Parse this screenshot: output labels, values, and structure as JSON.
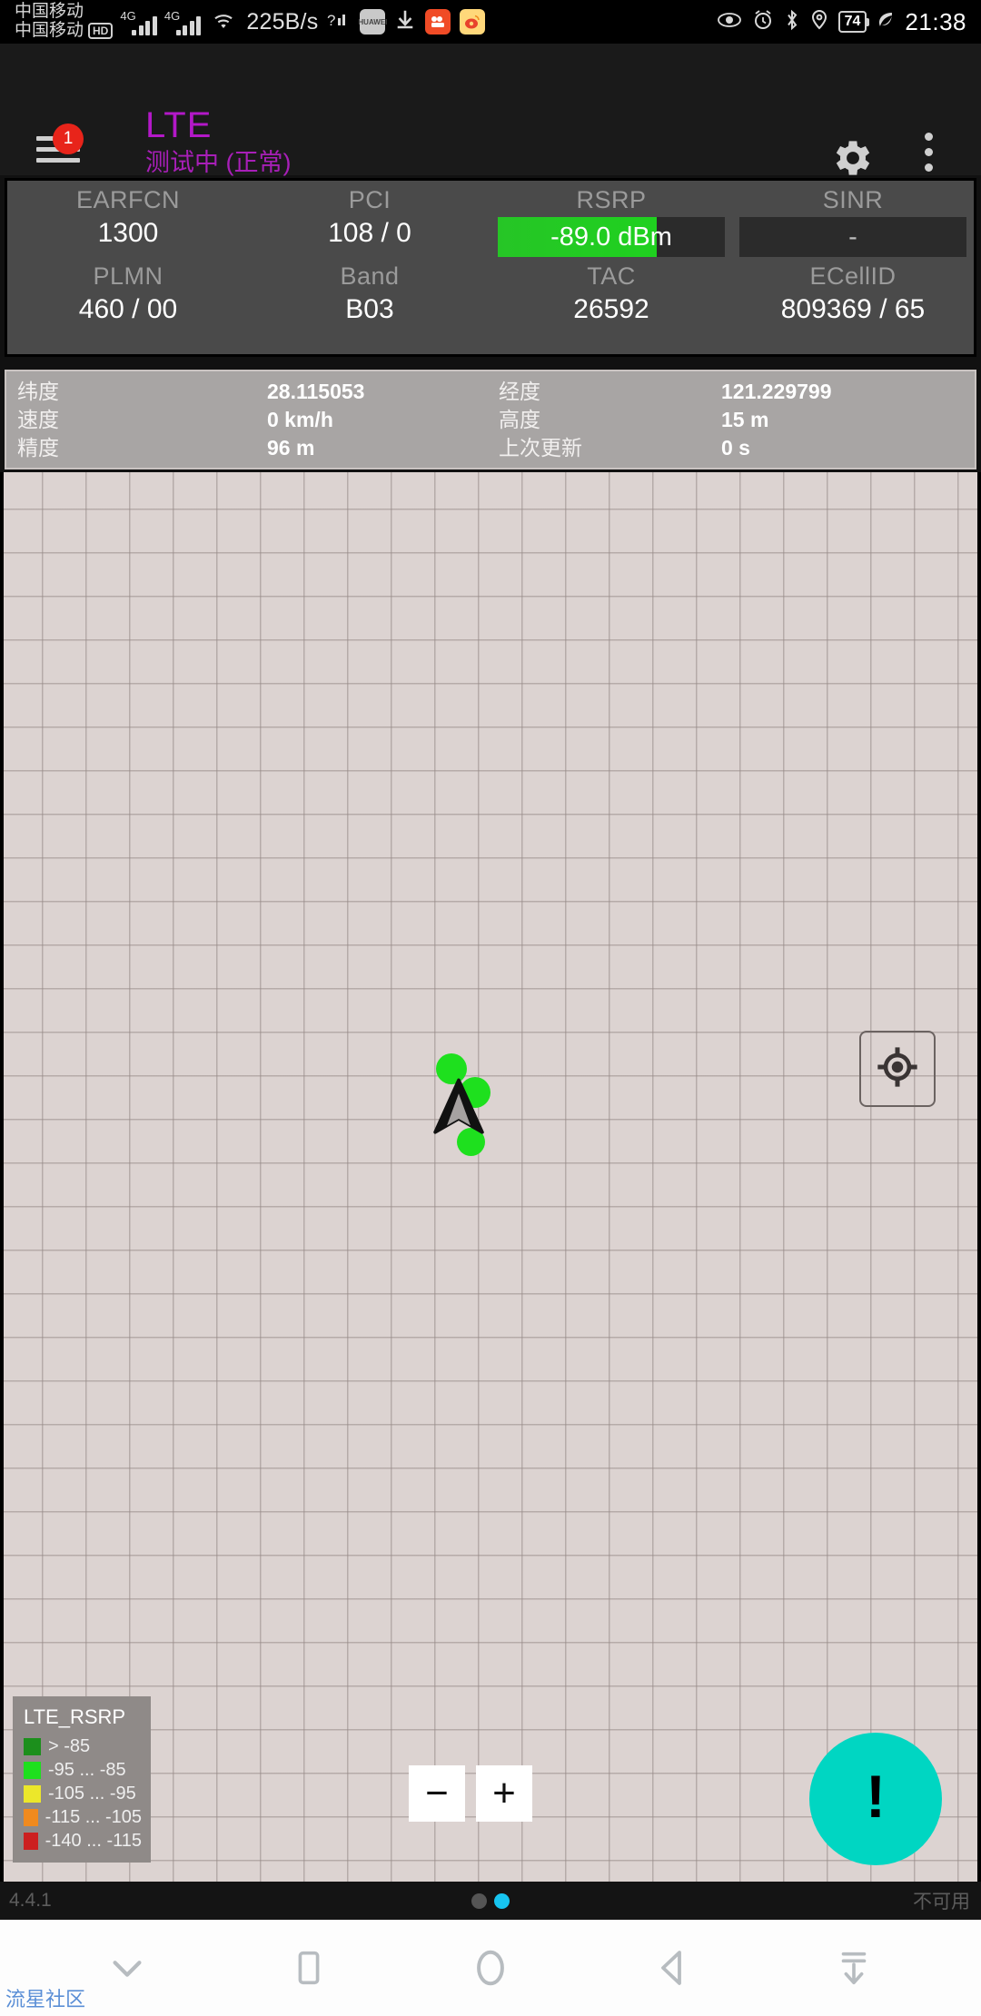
{
  "status_bar": {
    "carrier_line1": "中国移动",
    "carrier_line2": "中国移动",
    "volte_badge": "HD",
    "network_type_1": "4G",
    "network_type_2": "4G",
    "network_speed": "225B/s",
    "unknown_sim_icon": "?",
    "app_icon_huawei": "HUAWEI",
    "app_icon_download": "download-icon",
    "app_icon_recorder": "recorder-icon",
    "app_icon_weibo": "weibo-icon",
    "eye_icon": "eye-comfort-icon",
    "alarm_icon": "alarm-icon",
    "bluetooth_icon": "bluetooth-icon",
    "location_icon": "location-icon",
    "battery_level": "74",
    "power_save_icon": "leaf-icon",
    "clock": "21:38"
  },
  "app_bar": {
    "menu_badge": "1",
    "title": "LTE",
    "subtitle": "测试中 (正常)",
    "settings_icon": "gear-icon",
    "overflow_icon": "more-vertical-icon",
    "title_color": "#b318c8"
  },
  "stats": {
    "row1": [
      {
        "label": "EARFCN",
        "value": "1300",
        "type": "text"
      },
      {
        "label": "PCI",
        "value": "108 / 0",
        "type": "text"
      },
      {
        "label": "RSRP",
        "value": "-89.0 dBm",
        "type": "bar",
        "fill_percent": 70,
        "fill_color": "#1fd11f"
      },
      {
        "label": "SINR",
        "value": "-",
        "type": "bar",
        "fill_percent": 0,
        "fill_color": "#1fd11f"
      }
    ],
    "row2": [
      {
        "label": "PLMN",
        "value": "460 / 00"
      },
      {
        "label": "Band",
        "value": "B03"
      },
      {
        "label": "TAC",
        "value": "26592"
      },
      {
        "label": "ECellID",
        "value": "809369 / 65"
      }
    ]
  },
  "gps": {
    "latitude_label": "纬度",
    "latitude_value": "28.115053",
    "longitude_label": "经度",
    "longitude_value": "121.229799",
    "speed_label": "速度",
    "speed_value": "0 km/h",
    "altitude_label": "高度",
    "altitude_value": "15 m",
    "accuracy_label": "精度",
    "accuracy_value": "96 m",
    "last_update_label": "上次更新",
    "last_update_value": "0 s"
  },
  "map": {
    "locate_icon": "crosshair-icon",
    "zoom_out_label": "−",
    "zoom_in_label": "+",
    "alert_fab_label": "!",
    "alert_fab_color": "#00d6c2",
    "marker_icon": "navigation-arrow-icon",
    "sample_dot_color": "#1ee01e",
    "background_color": "#dcd3d1"
  },
  "legend": {
    "title": "LTE_RSRP",
    "items": [
      {
        "color": "#1c8f1c",
        "range": "> -85"
      },
      {
        "color": "#1ee01e",
        "range": "-95 ... -85"
      },
      {
        "color": "#ece72a",
        "range": "-105 ... -95"
      },
      {
        "color": "#f08a1e",
        "range": "-115 ... -105"
      },
      {
        "color": "#cc2020",
        "range": "-140 ... -115"
      }
    ]
  },
  "footer": {
    "version": "4.4.1",
    "status": "不可用",
    "page_index": 1,
    "page_count": 2
  },
  "nav_bar": {
    "buttons": [
      {
        "name": "hide-navbar-button",
        "icon": "chevron-down-icon"
      },
      {
        "name": "recents-button",
        "icon": "square-icon"
      },
      {
        "name": "home-button",
        "icon": "circle-icon"
      },
      {
        "name": "back-button",
        "icon": "triangle-left-icon"
      },
      {
        "name": "notification-pull-button",
        "icon": "pull-down-icon"
      }
    ]
  },
  "watermark": {
    "text": "流星社区"
  }
}
